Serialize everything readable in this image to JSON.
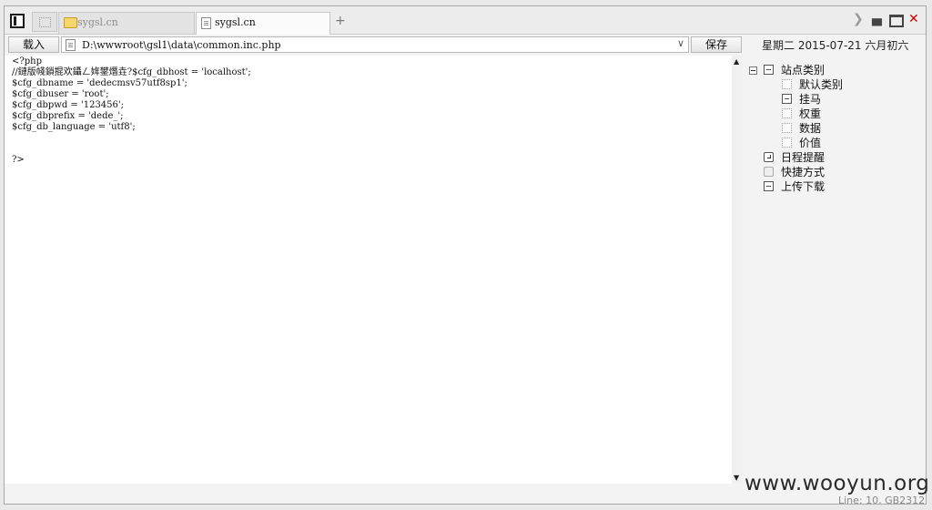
{
  "tabs": [
    {
      "label": "sygsl.cn",
      "icon": "folder-icon",
      "active": false
    },
    {
      "label": "sygsl.cn",
      "icon": "file-icon",
      "active": true
    }
  ],
  "toolbar": {
    "load_label": "载入",
    "path": "D:\\wwwroot\\gsl1\\data\\common.inc.php",
    "save_label": "保存"
  },
  "date_info": "星期二  2015-07-21  六月初六",
  "editor": {
    "lines": [
      "<?php",
      "//鏈版帴鎻掍欢鑷ㄥ姩鐢熸垚?$cfg_dbhost = 'localhost';",
      "$cfg_dbname = 'dedecmsv57utf8sp1';",
      "$cfg_dbuser = 'root';",
      "$cfg_dbpwd = '123456';",
      "$cfg_dbprefix = 'dede_';",
      "$cfg_db_language = 'utf8';",
      "",
      "",
      "?>"
    ]
  },
  "sidebar": {
    "root_label": "站点类别",
    "categories": [
      "默认类别",
      "挂马",
      "权重",
      "数据",
      "价值"
    ],
    "schedule_label": "日程提醒",
    "shortcut_label": "快捷方式",
    "transfer_label": "上传下载"
  },
  "status": "Line: 10, GB2312",
  "watermark": "www.wooyun.org"
}
